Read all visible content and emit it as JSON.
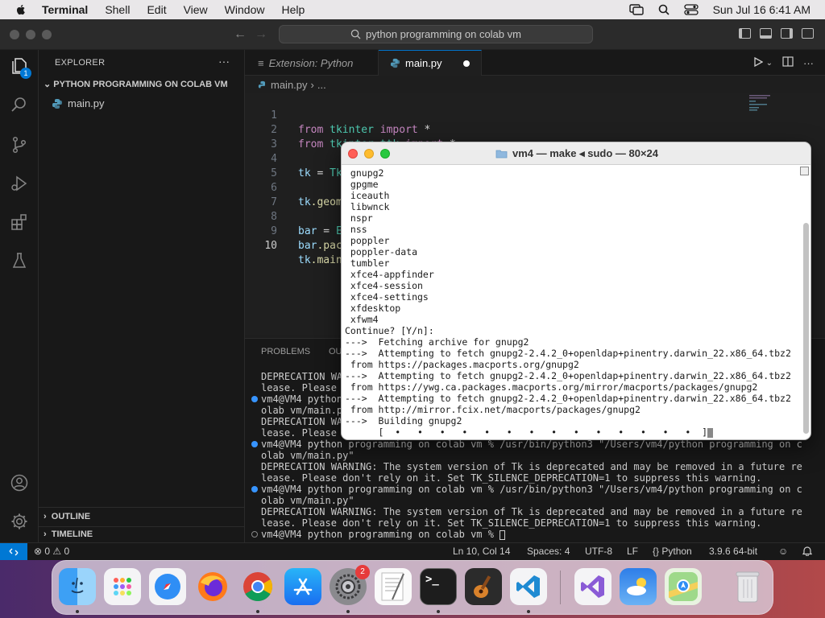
{
  "menubar": {
    "app": "Terminal",
    "items": [
      "Shell",
      "Edit",
      "View",
      "Window",
      "Help"
    ],
    "datetime": "Sun Jul 16  6:41 AM",
    "icons": [
      "apple-icon",
      "screen-mirroring-icon",
      "search-icon",
      "control-center-icon"
    ]
  },
  "titlebar": {
    "search": "python programming on colab vm"
  },
  "activitybar": {
    "explorer_badge": "1",
    "icons": [
      "explorer-icon",
      "search-icon",
      "source-control-icon",
      "run-debug-icon",
      "extensions-icon",
      "testing-icon",
      "account-icon",
      "settings-gear-icon"
    ]
  },
  "sidebar": {
    "title": "EXPLORER",
    "more": "···",
    "folder": "PYTHON PROGRAMMING ON COLAB VM",
    "file": "main.py",
    "outline": "OUTLINE",
    "timeline": "TIMELINE"
  },
  "editor": {
    "tabs": [
      {
        "label": "Extension: Python"
      },
      {
        "label": "main.py"
      }
    ],
    "breadcrumb": [
      "main.py",
      "..."
    ],
    "lines": [
      {
        "n": "1"
      },
      {
        "n": "2"
      },
      {
        "n": "3"
      },
      {
        "n": "4"
      },
      {
        "n": "5"
      },
      {
        "n": "6"
      },
      {
        "n": "7"
      },
      {
        "n": "8"
      },
      {
        "n": "9"
      },
      {
        "n": "10"
      }
    ],
    "code": {
      "l1": {
        "a": "from",
        "b": " tkinter ",
        "c": "import",
        "d": " *"
      },
      "l2": {
        "a": "from",
        "b": " tkinter.ttk ",
        "c": "import",
        "d": " *"
      },
      "l4": {
        "a": "tk",
        "b": " = ",
        "c": "Tk()"
      },
      "l6": {
        "a": "tk",
        "b": ".geom"
      },
      "l8": {
        "a": "bar",
        "b": " = ",
        "c": "E"
      },
      "l9": {
        "a": "bar",
        "b": ".pac"
      },
      "l10": {
        "a": "tk",
        "b": ".main"
      }
    }
  },
  "panel": {
    "tabs": [
      "PROBLEMS",
      "OU"
    ],
    "lines": [
      "DEPRECATION WA",
      "lease. Please",
      "vm4@VM4 python",
      "olab vm/main.p",
      "DEPRECATION WA",
      "lease. Please",
      "vm4@VM4 python programming on colab vm % /usr/bin/python3 \"/Users/vm4/python programming on c",
      "olab vm/main.py\"",
      "DEPRECATION WARNING: The system version of Tk is deprecated and may be removed in a future re",
      "lease. Please don't rely on it. Set TK_SILENCE_DEPRECATION=1 to suppress this warning.",
      "vm4@VM4 python programming on colab vm % /usr/bin/python3 \"/Users/vm4/python programming on c",
      "olab vm/main.py\"",
      "DEPRECATION WARNING: The system version of Tk is deprecated and may be removed in a future re",
      "lease. Please don't rely on it. Set TK_SILENCE_DEPRECATION=1 to suppress this warning.",
      "vm4@VM4 python programming on colab vm % "
    ]
  },
  "statusbar": {
    "problems": "⊗ 0 ⚠ 0",
    "position": "Ln 10, Col 14",
    "spaces": "Spaces: 4",
    "encoding": "UTF-8",
    "eol": "LF",
    "language": "{} Python",
    "interpreter": "3.9.6 64-bit"
  },
  "terminal_window": {
    "title": "vm4 — make ◂ sudo — 80×24",
    "lines": [
      " gnupg2",
      " gpgme",
      " iceauth",
      " libwnck",
      " nspr",
      " nss",
      " poppler",
      " poppler-data",
      " tumbler",
      " xfce4-appfinder",
      " xfce4-session",
      " xfce4-settings",
      " xfdesktop",
      " xfwm4",
      "Continue? [Y/n]:",
      "--->  Fetching archive for gnupg2",
      "--->  Attempting to fetch gnupg2-2.4.2_0+openldap+pinentry.darwin_22.x86_64.tbz2",
      " from https://packages.macports.org/gnupg2",
      "--->  Attempting to fetch gnupg2-2.4.2_0+openldap+pinentry.darwin_22.x86_64.tbz2",
      " from https://ywg.ca.packages.macports.org/mirror/macports/packages/gnupg2",
      "--->  Attempting to fetch gnupg2-2.4.2_0+openldap+pinentry.darwin_22.x86_64.tbz2",
      " from http://mirror.fcix.net/macports/packages/gnupg2",
      "--->  Building gnupg2",
      "      [  •   •   •   •   •   •   •   •   •   •   •   •   •   •  ]"
    ]
  },
  "dock": {
    "apps": [
      "finder-icon",
      "launchpad-icon",
      "safari-icon",
      "firefox-icon",
      "chrome-icon",
      "app-store-icon",
      "system-settings-icon",
      "textedit-icon",
      "terminal-icon",
      "garageband-icon",
      "vscode-icon",
      "visual-studio-icon",
      "weather-icon",
      "maps-icon",
      "trash-icon"
    ],
    "settings_badge": "2",
    "colors": {
      "accent": "#0078d4"
    }
  }
}
